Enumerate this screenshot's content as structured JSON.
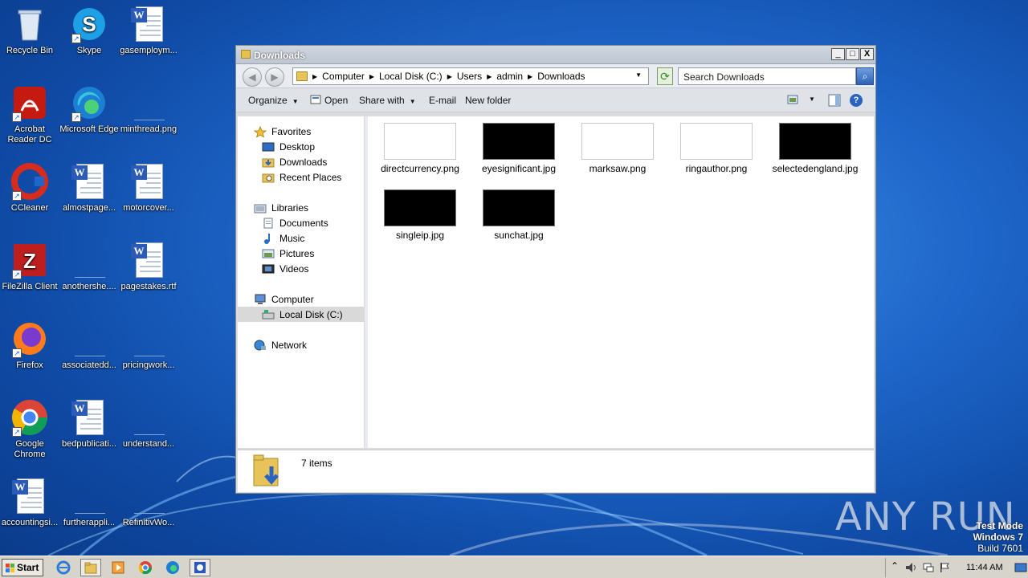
{
  "desktop": {
    "icons": [
      {
        "label": "Recycle Bin",
        "icon": "recycle-bin-icon"
      },
      {
        "label": "Skype",
        "icon": "skype-icon"
      },
      {
        "label": "gasemploym...",
        "icon": "word-document-icon"
      },
      {
        "label": "Acrobat Reader DC",
        "icon": "acrobat-icon"
      },
      {
        "label": "Microsoft Edge",
        "icon": "edge-icon"
      },
      {
        "label": "minthread.png",
        "icon": "image-file-icon"
      },
      {
        "label": "CCleaner",
        "icon": "ccleaner-icon"
      },
      {
        "label": "almostpage...",
        "icon": "word-document-icon"
      },
      {
        "label": "motorcover...",
        "icon": "word-document-icon"
      },
      {
        "label": "FileZilla Client",
        "icon": "filezilla-icon"
      },
      {
        "label": "anothershe....",
        "icon": "image-file-icon"
      },
      {
        "label": "pagestakes.rtf",
        "icon": "word-document-icon"
      },
      {
        "label": "Firefox",
        "icon": "firefox-icon"
      },
      {
        "label": "associatedd...",
        "icon": "image-file-icon"
      },
      {
        "label": "pricingwork...",
        "icon": "image-file-icon"
      },
      {
        "label": "Google Chrome",
        "icon": "chrome-icon"
      },
      {
        "label": "bedpublicati...",
        "icon": "word-document-icon"
      },
      {
        "label": "understand...",
        "icon": "image-file-icon"
      },
      {
        "label": "accountingsi...",
        "icon": "word-document-icon"
      },
      {
        "label": "furtherappli...",
        "icon": "image-file-icon"
      },
      {
        "label": "RefinitivWo...",
        "icon": "image-file-icon"
      }
    ]
  },
  "window": {
    "title": "Downloads",
    "controls": {
      "minimize": "_",
      "maximize": "□",
      "close": "X"
    },
    "breadcrumb": [
      "Computer",
      "Local Disk (C:)",
      "Users",
      "admin",
      "Downloads"
    ],
    "search_placeholder": "Search Downloads",
    "toolbar": {
      "organize": "Organize",
      "open": "Open",
      "share_with": "Share with",
      "email": "E-mail",
      "new_folder": "New folder"
    },
    "nav": {
      "favorites": "Favorites",
      "desktop": "Desktop",
      "downloads": "Downloads",
      "recent_places": "Recent Places",
      "libraries": "Libraries",
      "documents": "Documents",
      "music": "Music",
      "pictures": "Pictures",
      "videos": "Videos",
      "computer": "Computer",
      "local_disk": "Local Disk (C:)",
      "network": "Network"
    },
    "files": [
      {
        "name": "directcurrency.png",
        "thumb": "light"
      },
      {
        "name": "eyesignificant.jpg",
        "thumb": "dark"
      },
      {
        "name": "marksaw.png",
        "thumb": "light"
      },
      {
        "name": "ringauthor.png",
        "thumb": "light"
      },
      {
        "name": "selectedengland.jpg",
        "thumb": "dark"
      },
      {
        "name": "singleip.jpg",
        "thumb": "dark"
      },
      {
        "name": "sunchat.jpg",
        "thumb": "dark"
      }
    ],
    "status": {
      "items": "7 items"
    }
  },
  "taskbar": {
    "start": "Start",
    "clock": "11:44 AM"
  },
  "watermark": {
    "brand": "ANY RUN",
    "mode": "Test Mode",
    "os": "Windows 7",
    "build": "Build 7601"
  },
  "colors": {
    "desktop_blue": "#1e66c9",
    "title_bar": "#c4ccd6",
    "selection": "#d9d9d9"
  }
}
